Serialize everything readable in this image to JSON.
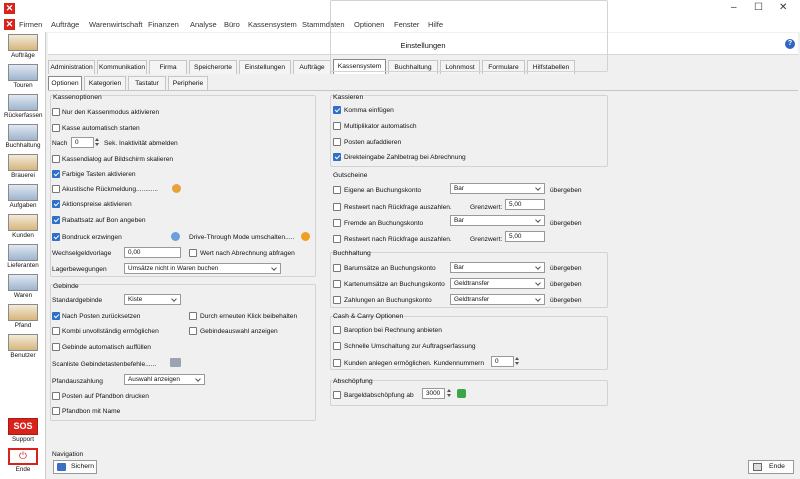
{
  "menu": [
    "Firmen",
    "Aufträge",
    "Warenwirtschaft",
    "Finanzen",
    "Analyse",
    "Büro",
    "Kassensystem",
    "Stammdaten",
    "Optionen",
    "Fenster",
    "Hilfe"
  ],
  "window_buttons": {
    "close": "✕",
    "minimize": "–",
    "maximize": "☐"
  },
  "sidebar": [
    "Aufträge",
    "Touren",
    "Rückerfassen",
    "Buchhaltung",
    "Brauerei",
    "Aufgaben",
    "Kunden",
    "Lieferanten",
    "Waren",
    "Pfand",
    "Benutzer"
  ],
  "sidebar_bottom": {
    "sos_icon": "SOS",
    "support": "Support",
    "ende_icon": "⏻",
    "ende": "Ende"
  },
  "header": {
    "title": "Einstellungen",
    "help_icon": "?"
  },
  "tabs": [
    "Administration",
    "Kommunikation",
    "Firma",
    "Speicherorte",
    "Einstellungen",
    "Aufträge",
    "Kassensystem",
    "Buchhaltung",
    "Lohnmost",
    "Formulare",
    "Hilfstabellen"
  ],
  "subtabs": [
    "Optionen",
    "Kategorien",
    "Tastatur",
    "Peripherie"
  ],
  "kassenoptionen": {
    "title": "Kassenoptionen",
    "kassenmodus": "Nur den Kassenmodus aktivieren",
    "autostart": "Kasse automatisch starten",
    "nach": "Nach",
    "nach_value": "0",
    "sek": "Sek. Inaktivität abmelden",
    "skalieren": "Kassendialog auf Bildschirm skalieren",
    "farbige": "Farbige Tasten aktivieren",
    "akustische": "Akustische Rückmeldung............",
    "aktionspreise": "Aktionspreise aktivieren",
    "rabattsatz": "Rabattsatz auf Bon angeben",
    "bondruck": "Bondruck erzwingen",
    "drive": "Drive-Through Mode umschalten.....",
    "wechselgeld": "Wechselgeldvorlage",
    "wechselgeld_value": "0,00",
    "wert": "Wert nach Abrechnung abfragen",
    "lagerbewegungen": "Lagerbewegungen",
    "lagerbewegungen_value": "Umsätze nicht in Waren buchen"
  },
  "gebinde": {
    "title": "Gebinde",
    "standard": "Standardgebinde",
    "standard_value": "Kiste",
    "nach_posten": "Nach Posten zurücksetzen",
    "durch_klick": "Durch erneuten Klick beibehalten",
    "kombi": "Kombi unvollständig ermöglichen",
    "gebindeauswahl": "Gebindeauswahl anzeigen",
    "auffuellen": "Gebinde automatisch auffüllen",
    "scanliste": "Scanliste Gebindetastenbefehle......",
    "pfandauszahlung": "Pfandauszahlung",
    "pfandauszahlung_value": "Auswahl anzeigen",
    "posten_drucken": "Posten auf Pfandbon drucken",
    "pfandbon_name": "Pfandbon mit Name"
  },
  "kassieren": {
    "title": "Kassieren",
    "komma": "Komma einfügen",
    "multiplikator": "Multiplikator automatisch",
    "posten_addieren": "Posten aufaddieren",
    "direkteingabe": "Direkteingabe Zahlbetrag bei Abrechnung"
  },
  "gutscheine": {
    "title": "Gutscheine",
    "eigene": "Eigene an Buchungskonto",
    "eigene_value": "Bar",
    "uebergeben": "übergeben",
    "restwert1": "Restwert nach Rückfrage auszahlen.",
    "grenzwert": "Grenzwert:",
    "grenzwert1": "5,00",
    "fremde": "Fremde an Buchungskonto",
    "fremde_value": "Bar",
    "restwert2": "Restwert nach Rückfrage auszahlen.",
    "grenzwert2": "5,00"
  },
  "buchhaltung": {
    "title": "Buchhaltung",
    "barumsaetze": "Barumsätze an Buchungskonto",
    "barumsaetze_value": "Bar",
    "kartenumsaetze": "Kartenumsätze an Buchungskonto",
    "kartenumsaetze_value": "Geldtransfer",
    "zahlungen": "Zahlungen an Buchungskonto",
    "zahlungen_value": "Geldtransfer",
    "uebergeben": "übergeben"
  },
  "cash_carry": {
    "title": "Cash & Carry Optionen",
    "baroption": "Baroption bei Rechnung anbieten",
    "schnelle": "Schnelle Umschaltung zur Auftragserfassung",
    "kunden": "Kunden anlegen ermöglichen. Kundennummern",
    "kunden_value": "0"
  },
  "abschoepfung": {
    "title": "Abschöpfung",
    "bargeld": "Bargeldabschöpfung ab",
    "bargeld_value": "3000"
  },
  "navigation": {
    "title": "Navigation",
    "sichern": "Sichern",
    "ende": "Ende"
  },
  "colors": {
    "accent": "#2f6fc7",
    "brand": "#d8231d"
  }
}
